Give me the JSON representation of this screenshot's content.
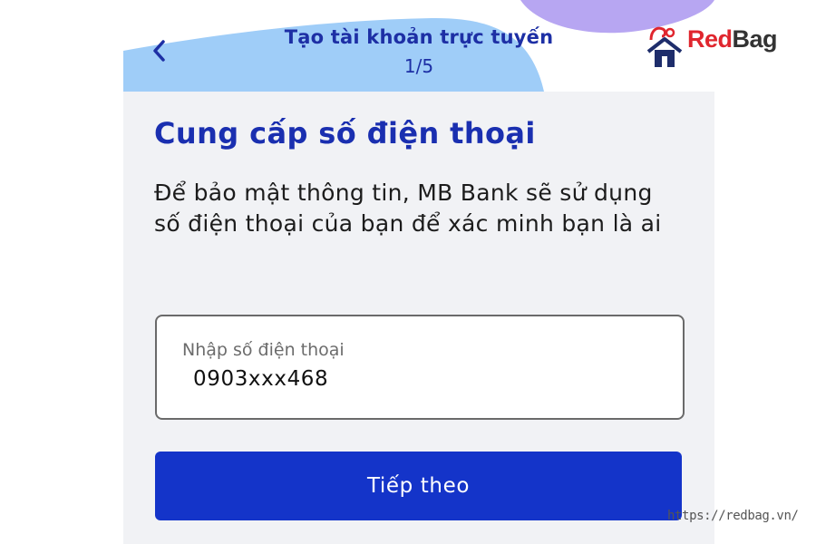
{
  "header": {
    "title": "Tạo tài khoản trực tuyến",
    "step": "1/5"
  },
  "main": {
    "title": "Cung cấp số điện thoại",
    "description": "Để bảo mật thông tin, MB Bank sẽ sử dụng số điện thoại của bạn để xác minh bạn là ai",
    "phone_field": {
      "label": "Nhập số điện thoại",
      "value": "0903xxx468"
    },
    "next_button": "Tiếp theo"
  },
  "watermark": {
    "logo_text": "RedBag",
    "url": "https://redbag.vn/"
  },
  "colors": {
    "brand_blue": "#1434c9",
    "title_blue": "#1a2fb0",
    "header_wave": "#9fcdf8",
    "header_blob": "#b7a6f2",
    "logo_red": "#e0262e",
    "logo_navy": "#1e2d6b"
  },
  "icons": [
    "back-chevron-icon",
    "redbag-house-icon"
  ]
}
